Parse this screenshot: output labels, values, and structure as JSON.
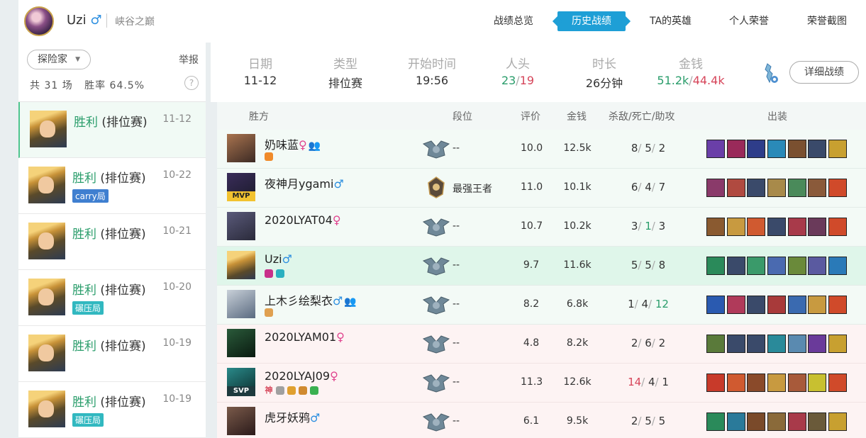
{
  "header": {
    "user_name": "Uzi",
    "gender_symbol": "♂",
    "server": "峡谷之巅",
    "nav": [
      "战绩总览",
      "历史战绩",
      "TA的英雄",
      "个人荣誉",
      "荣誉截图"
    ],
    "nav_active_index": 1
  },
  "left": {
    "filter_label": "探险家",
    "report_label": "举报",
    "total_label": "共",
    "total_count": "31",
    "total_unit": "场",
    "winrate_label": "胜率",
    "winrate": "64.5%",
    "help": "?",
    "matches": [
      {
        "result": "胜利",
        "type": "(排位赛)",
        "date": "11-12",
        "tag": ""
      },
      {
        "result": "胜利",
        "type": "(排位赛)",
        "date": "10-22",
        "tag": "carry局"
      },
      {
        "result": "胜利",
        "type": "(排位赛)",
        "date": "10-21",
        "tag": ""
      },
      {
        "result": "胜利",
        "type": "(排位赛)",
        "date": "10-20",
        "tag": "碾压局"
      },
      {
        "result": "胜利",
        "type": "(排位赛)",
        "date": "10-19",
        "tag": ""
      },
      {
        "result": "胜利",
        "type": "(排位赛)",
        "date": "10-19",
        "tag": "碾压局"
      }
    ]
  },
  "summary": {
    "date_label": "日期",
    "date": "11-12",
    "type_label": "类型",
    "type": "排位赛",
    "start_label": "开始时间",
    "start": "19:56",
    "kills_label": "人头",
    "kills_win": "23",
    "kills_lose": "19",
    "duration_label": "时长",
    "duration": "26分钟",
    "gold_label": "金钱",
    "gold_win": "51.2k",
    "gold_lose": "44.4k",
    "detail_button": "详细战绩"
  },
  "table": {
    "headers": {
      "team": "胜方",
      "rank": "段位",
      "score": "评价",
      "gold": "金钱",
      "kda": "杀敌/死亡/助攻",
      "items": "出装"
    },
    "rows": [
      {
        "name": "奶味蓝",
        "gender": "♀",
        "friend": true,
        "rank": "--",
        "score": "10.0",
        "gold": "12.5k",
        "k": "8",
        "d": "5",
        "a": "2",
        "badge": "",
        "team": "win"
      },
      {
        "name": "夜神月ygami",
        "gender": "♂",
        "friend": false,
        "rank": "最强王者",
        "score": "11.0",
        "gold": "10.1k",
        "k": "6",
        "d": "4",
        "a": "7",
        "badge": "MVP",
        "team": "win"
      },
      {
        "name": "2020LYAT04",
        "gender": "♀",
        "friend": false,
        "rank": "--",
        "score": "10.7",
        "gold": "10.2k",
        "k": "3",
        "d": "1",
        "a": "3",
        "badge": "",
        "team": "win"
      },
      {
        "name": "Uzi",
        "gender": "♂",
        "friend": false,
        "rank": "--",
        "score": "9.7",
        "gold": "11.6k",
        "k": "5",
        "d": "5",
        "a": "8",
        "badge": "",
        "team": "me"
      },
      {
        "name": "上木彡绘梨衣",
        "gender": "♂",
        "friend": true,
        "rank": "--",
        "score": "8.2",
        "gold": "6.8k",
        "k": "1",
        "d": "4",
        "a": "12",
        "badge": "",
        "team": "win"
      },
      {
        "name": "2020LYAM01",
        "gender": "♀",
        "friend": false,
        "rank": "--",
        "score": "4.8",
        "gold": "8.2k",
        "k": "2",
        "d": "6",
        "a": "2",
        "badge": "",
        "team": "lose"
      },
      {
        "name": "2020LYAJ09",
        "gender": "♀",
        "friend": false,
        "rank": "--",
        "score": "11.3",
        "gold": "12.6k",
        "k": "14",
        "d": "4",
        "a": "1",
        "badge": "SVP",
        "team": "lose"
      },
      {
        "name": "虎牙妖鸦",
        "gender": "♂",
        "friend": false,
        "rank": "--",
        "score": "6.1",
        "gold": "9.5k",
        "k": "2",
        "d": "5",
        "a": "5",
        "badge": "",
        "team": "lose"
      }
    ],
    "svp_mini_label": "神"
  },
  "colors": {
    "accent": "#1e9fd6",
    "win": "#2a9d6b",
    "lose": "#d6455a"
  }
}
